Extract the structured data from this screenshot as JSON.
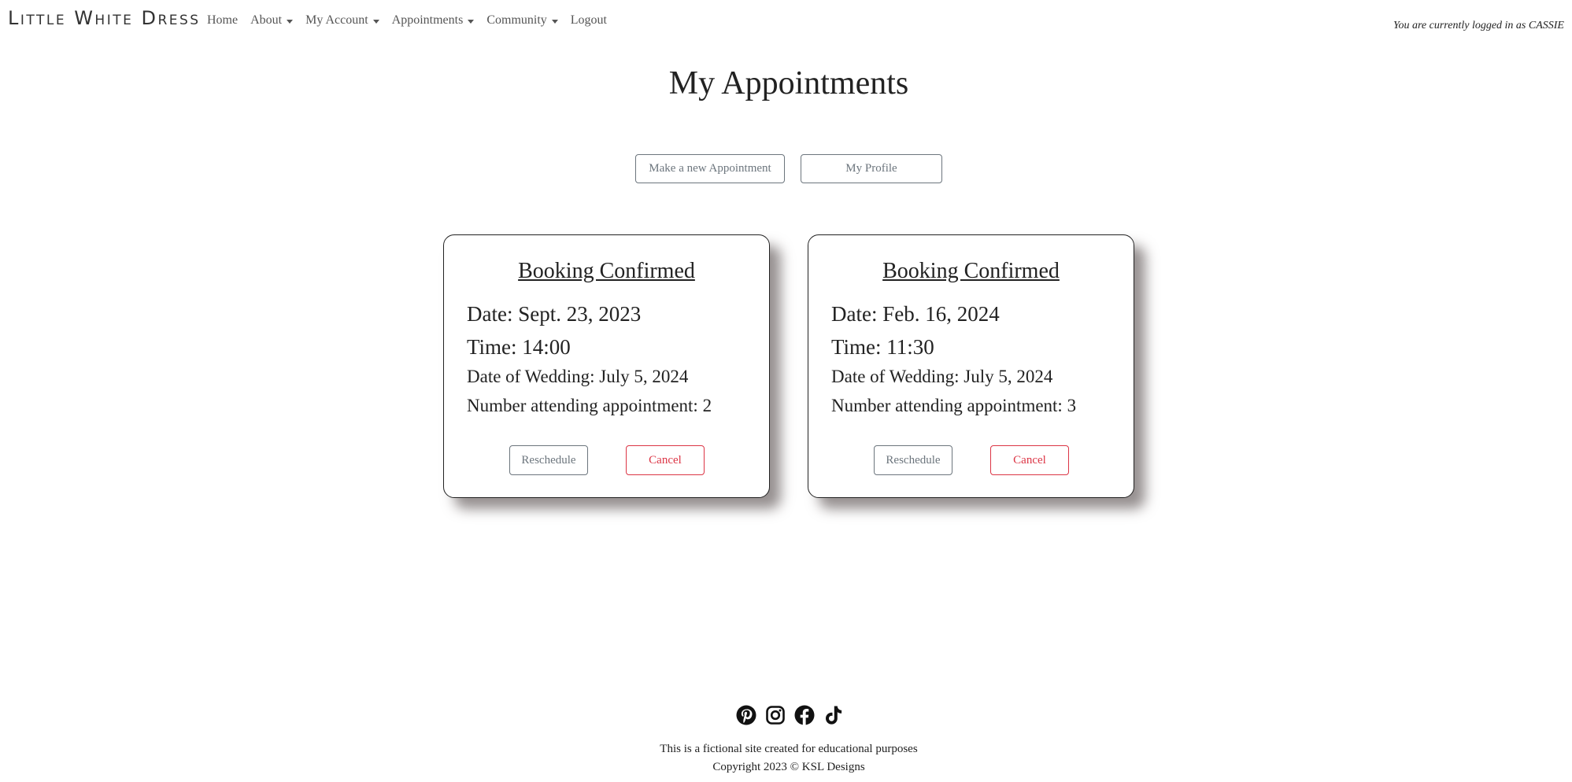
{
  "nav": {
    "brand": "Little White Dress",
    "items": [
      {
        "label": "Home",
        "dropdown": false
      },
      {
        "label": "About",
        "dropdown": true
      },
      {
        "label": "My Account",
        "dropdown": true
      },
      {
        "label": "Appointments",
        "dropdown": true
      },
      {
        "label": "Community",
        "dropdown": true
      },
      {
        "label": "Logout",
        "dropdown": false
      }
    ],
    "logged_in_text": "You are currently logged in as CASSIE"
  },
  "page": {
    "title": "My Appointments",
    "new_appointment_label": "Make a new Appointment",
    "profile_label": "My Profile"
  },
  "appointments": [
    {
      "status": "Booking Confirmed",
      "date": "Date: Sept. 23, 2023",
      "time": "Time: 14:00",
      "wedding_date": "Date of Wedding: July 5, 2024",
      "attending": "Number attending appointment: 2",
      "reschedule_label": "Reschedule",
      "cancel_label": "Cancel"
    },
    {
      "status": "Booking Confirmed",
      "date": "Date: Feb. 16, 2024",
      "time": "Time: 11:30",
      "wedding_date": "Date of Wedding: July 5, 2024",
      "attending": "Number attending appointment: 3",
      "reschedule_label": "Reschedule",
      "cancel_label": "Cancel"
    }
  ],
  "colors": {
    "secondary": "#6c757d",
    "danger": "#dc3545",
    "text": "#222222"
  },
  "footer": {
    "social_icons": [
      "pinterest-icon",
      "instagram-icon",
      "facebook-icon",
      "tiktok-icon"
    ],
    "line1": "This is a fictional site created for educational purposes",
    "line2": "Copyright 2023 © KSL Designs"
  }
}
